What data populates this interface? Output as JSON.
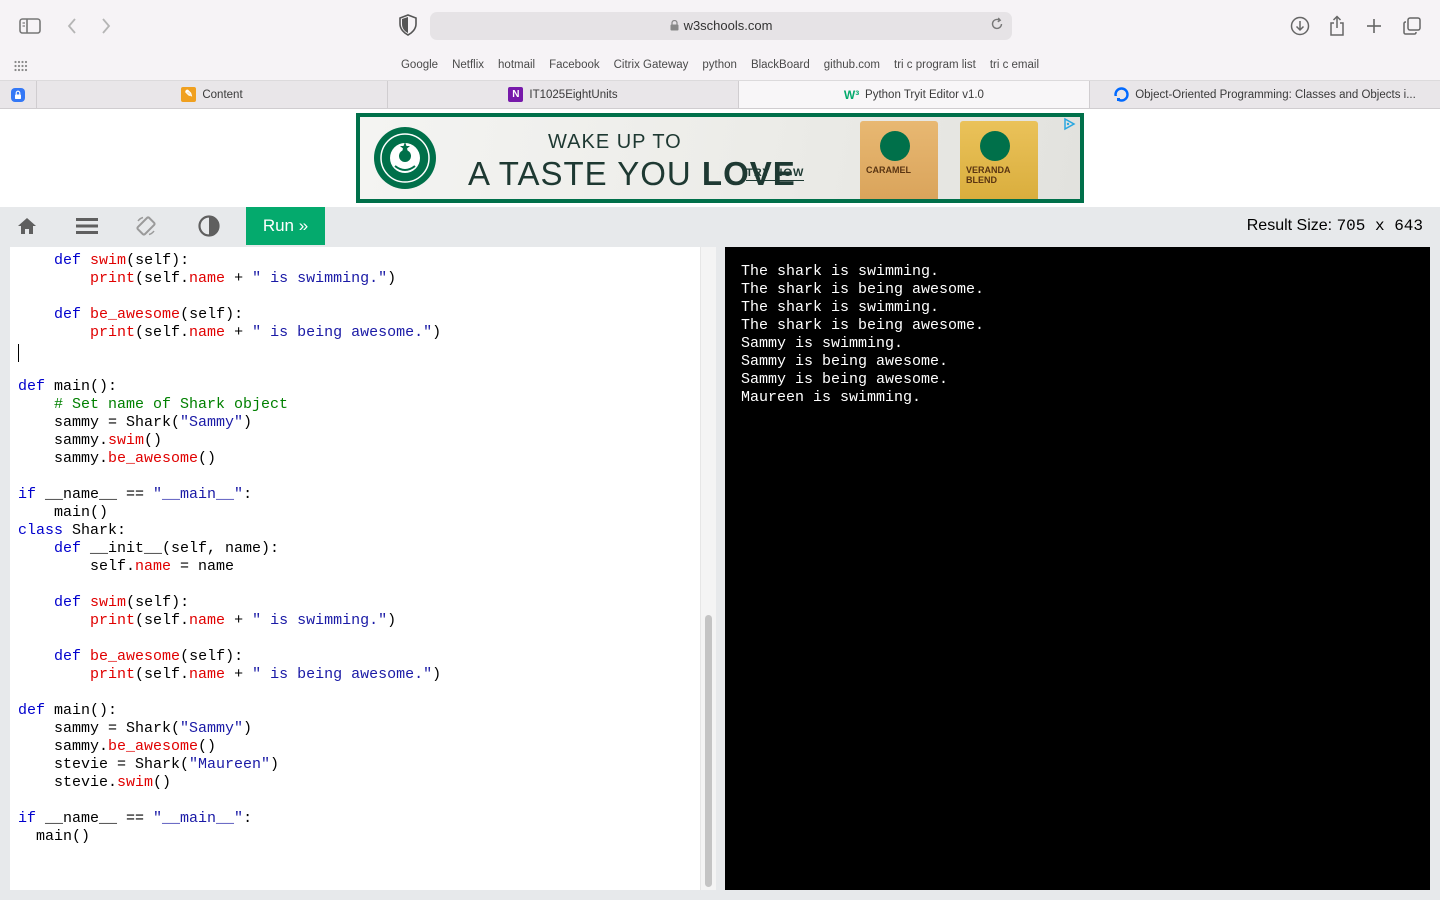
{
  "browser": {
    "url": "w3schools.com",
    "bookmarks": [
      "Google",
      "Netflix",
      "hotmail",
      "Facebook",
      "Citrix Gateway",
      "python",
      "BlackBoard",
      "github.com",
      "tri c program list",
      "tri c email"
    ],
    "tabs": [
      {
        "label": "Content",
        "icon": "content-favicon",
        "active": false
      },
      {
        "label": "IT1025EightUnits",
        "icon": "onenote-icon",
        "active": false
      },
      {
        "label": "Python Tryit Editor v1.0",
        "icon": "w3schools-icon",
        "active": true
      },
      {
        "label": "Object-Oriented Programming: Classes and Objects i...",
        "icon": "digitalocean-icon",
        "active": false
      }
    ]
  },
  "ad": {
    "line1": "WAKE UP TO",
    "line2_prefix": "A TASTE YOU ",
    "line2_bold": "LOVE",
    "cta": "TRY NOW",
    "bag1": "CARAMEL",
    "bag2": "VERANDA BLEND"
  },
  "editor": {
    "run_label": "Run »",
    "result_size_label": "Result Size:",
    "result_size_value": "705 x 643",
    "accent": "#04aa6d"
  },
  "code_lines": [
    "    def swim(self):",
    "        print(self.name + \" is swimming.\")",
    "",
    "    def be_awesome(self):",
    "        print(self.name + \" is being awesome.\")",
    "",
    "",
    "def main():",
    "    # Set name of Shark object",
    "    sammy = Shark(\"Sammy\")",
    "    sammy.swim()",
    "    sammy.be_awesome()",
    "",
    "if __name__ == \"__main__\":",
    "    main()",
    "class Shark:",
    "    def __init__(self, name):",
    "        self.name = name",
    "",
    "    def swim(self):",
    "        print(self.name + \" is swimming.\")",
    "",
    "    def be_awesome(self):",
    "        print(self.name + \" is being awesome.\")",
    "",
    "def main():",
    "    sammy = Shark(\"Sammy\")",
    "    sammy.be_awesome()",
    "    stevie = Shark(\"Maureen\")",
    "    stevie.swim()",
    "",
    "if __name__ == \"__main__\":",
    "  main()"
  ],
  "output_lines": [
    "The shark is swimming.",
    "The shark is being awesome.",
    "The shark is swimming.",
    "The shark is being awesome.",
    "Sammy is swimming.",
    "Sammy is being awesome.",
    "Sammy is being awesome.",
    "Maureen is swimming."
  ]
}
